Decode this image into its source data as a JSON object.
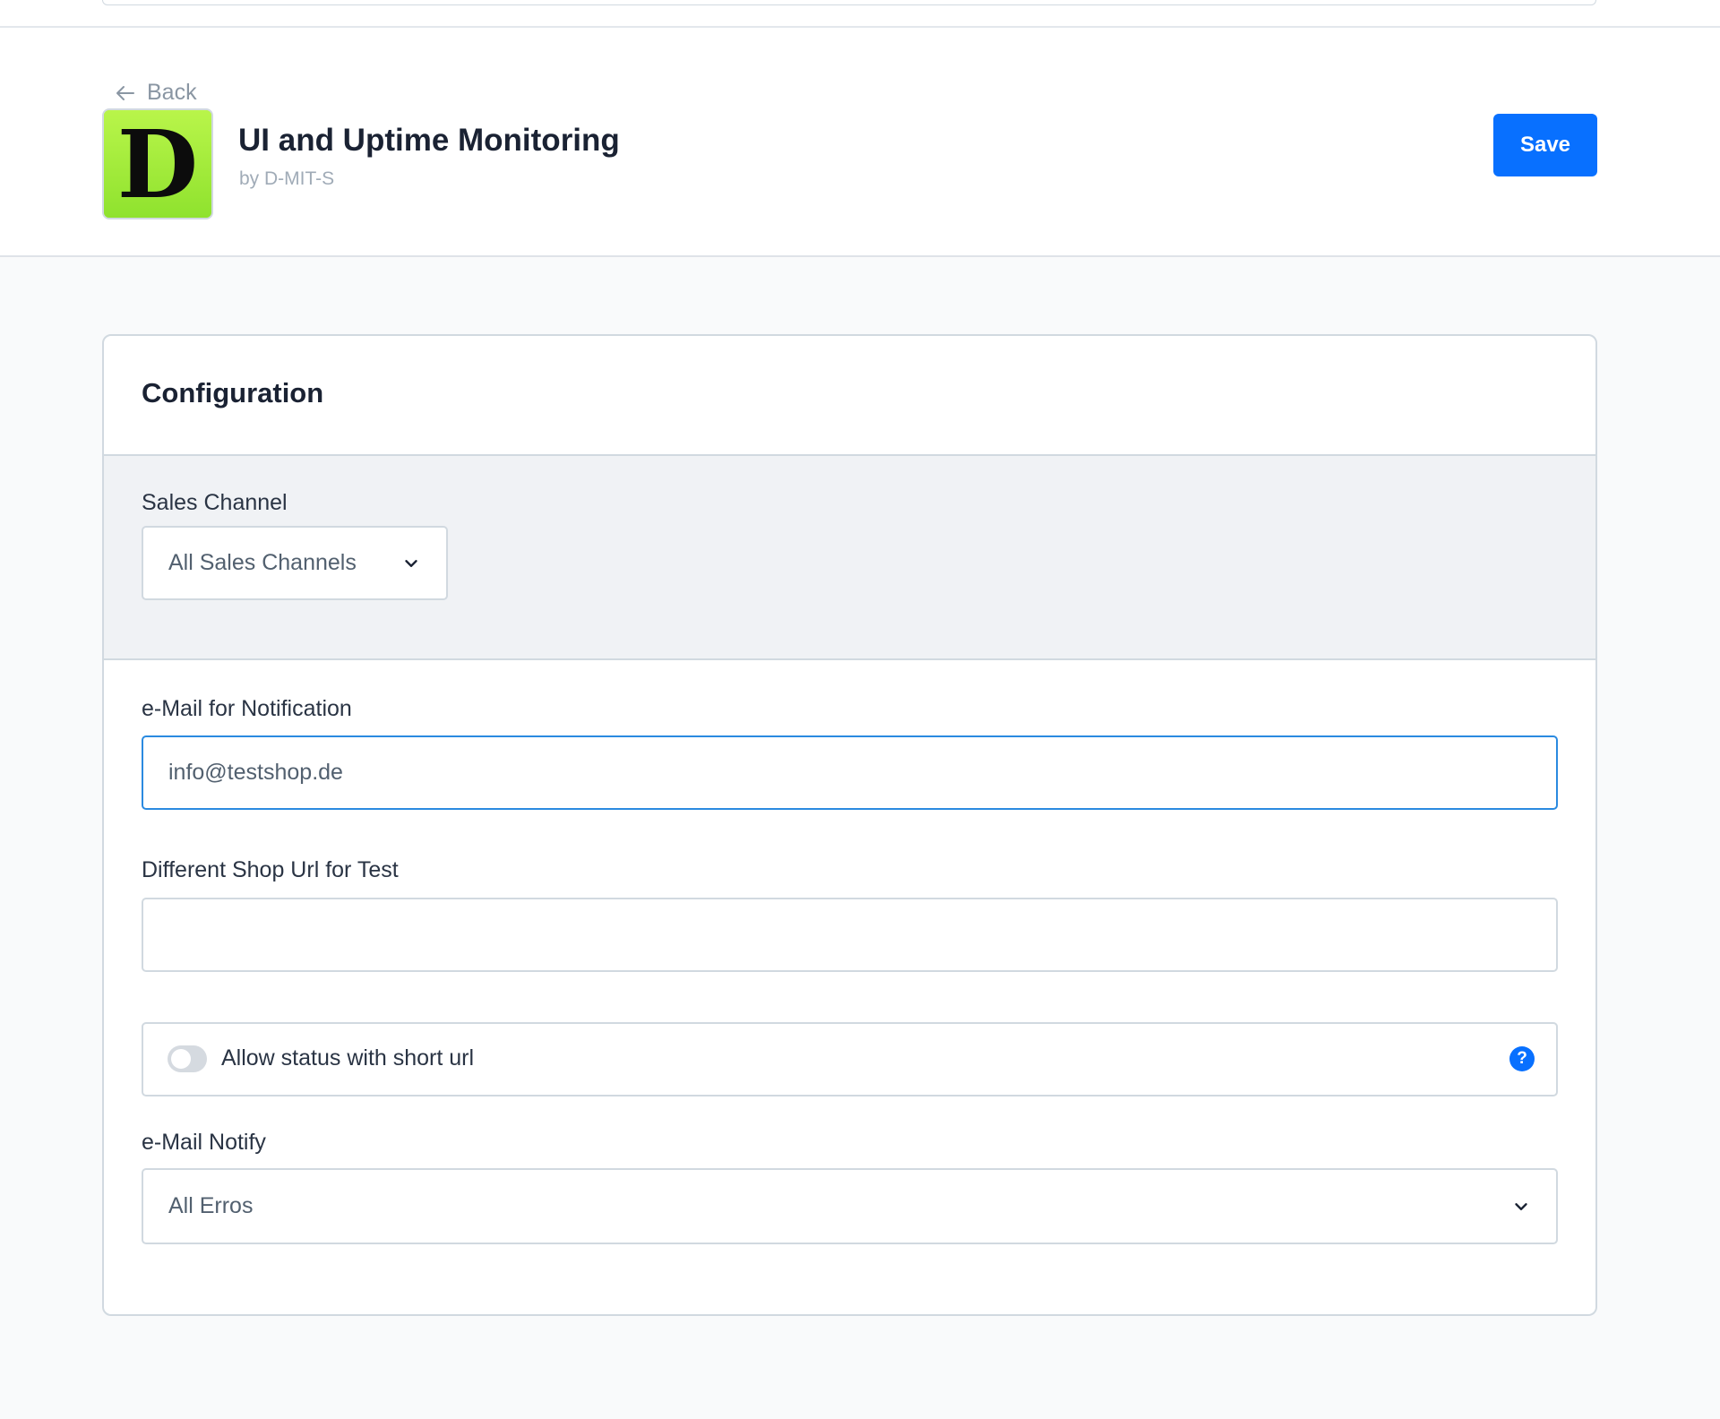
{
  "header": {
    "back_label": "Back",
    "app_title": "UI and Uptime Monitoring",
    "app_author": "by D-MIT-S",
    "logo_letter": "D",
    "save_label": "Save"
  },
  "config": {
    "title": "Configuration",
    "sales_channel": {
      "label": "Sales Channel",
      "selected": "All Sales Channels"
    },
    "email_notification": {
      "label": "e-Mail for Notification",
      "value": "info@testshop.de"
    },
    "shop_url": {
      "label": "Different Shop Url for Test",
      "value": ""
    },
    "short_url_toggle": {
      "label": "Allow status with short url",
      "enabled": false
    },
    "email_notify": {
      "label": "e-Mail Notify",
      "selected": "All Erros"
    }
  },
  "colors": {
    "primary": "#0870ff",
    "focus_border": "#2a8ae0",
    "logo_bg": "#a6f03a"
  },
  "icons": [
    "arrow-left-icon",
    "chevron-down-icon",
    "help-icon"
  ]
}
